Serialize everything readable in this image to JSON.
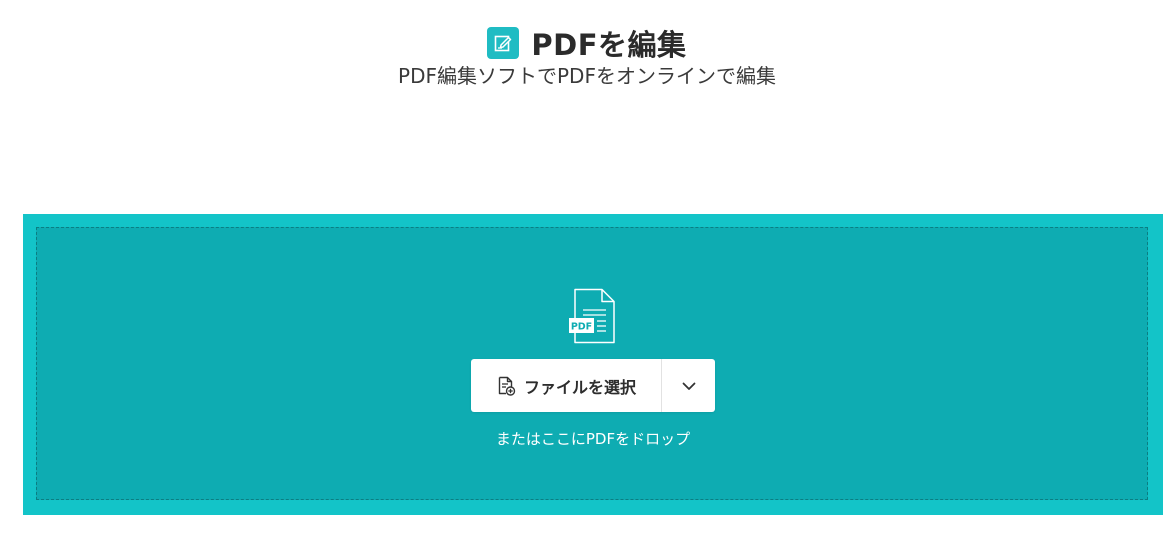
{
  "header": {
    "title": "PDFを編集",
    "subtitle": "PDF編集ソフトでPDFをオンラインで編集",
    "title_icon": "edit-document-icon"
  },
  "dropzone": {
    "file_badge": "PDF",
    "select_button_label": "ファイルを選択",
    "select_button_icon": "file-add-icon",
    "dropdown_icon": "chevron-down-icon",
    "drop_hint": "またはここにPDFをドロップ"
  },
  "colors": {
    "accent": "#1fbcc3",
    "dropzone_outer": "#13c4c8",
    "dropzone_inner": "#0eacb2"
  }
}
